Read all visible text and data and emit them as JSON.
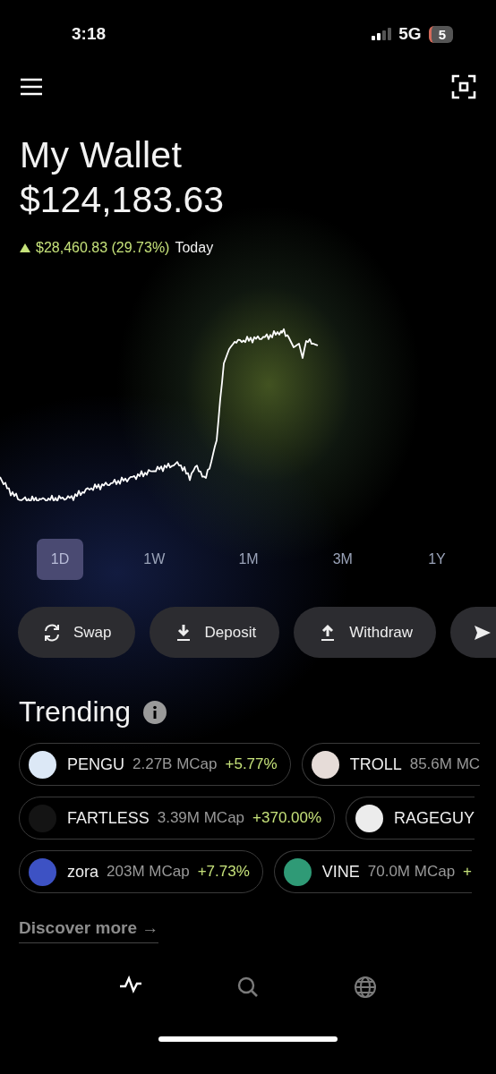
{
  "status_bar": {
    "time": "3:18",
    "network": "5G",
    "battery": "5"
  },
  "header": {
    "title": "My Wallet",
    "balance": "$124,183.63",
    "change": "$28,460.83 (29.73%)",
    "period": "Today"
  },
  "ranges": [
    {
      "label": "1D",
      "selected": true
    },
    {
      "label": "1W",
      "selected": false
    },
    {
      "label": "1M",
      "selected": false
    },
    {
      "label": "3M",
      "selected": false
    },
    {
      "label": "1Y",
      "selected": false
    }
  ],
  "actions": [
    {
      "kind": "swap",
      "label": "Swap"
    },
    {
      "kind": "deposit",
      "label": "Deposit"
    },
    {
      "kind": "withdraw",
      "label": "Withdraw"
    },
    {
      "kind": "send"
    }
  ],
  "trending": {
    "title": "Trending",
    "rows": [
      [
        {
          "name": "PENGU",
          "mcap": "2.27B MCap",
          "change": "+5.77%",
          "color": "#dce8f6"
        },
        {
          "name": "TROLL",
          "mcap": "85.6M MC",
          "color": "#e6dcd8"
        }
      ],
      [
        {
          "name": "FARTLESS",
          "mcap": "3.39M MCap",
          "change": "+370.00%",
          "color": "#141414"
        },
        {
          "name": "RAGEGUY",
          "color": "#ececec"
        }
      ],
      [
        {
          "name": "zora",
          "mcap": "203M MCap",
          "change": "+7.73%",
          "color": "#3d52c4"
        },
        {
          "name": "VINE",
          "mcap": "70.0M MCap",
          "change": "+",
          "color": "#2f9a76"
        }
      ]
    ],
    "more": "Discover more →"
  },
  "nav": [
    {
      "kind": "activity",
      "selected": true
    },
    {
      "kind": "search",
      "selected": false
    },
    {
      "kind": "globe",
      "selected": false
    }
  ]
}
